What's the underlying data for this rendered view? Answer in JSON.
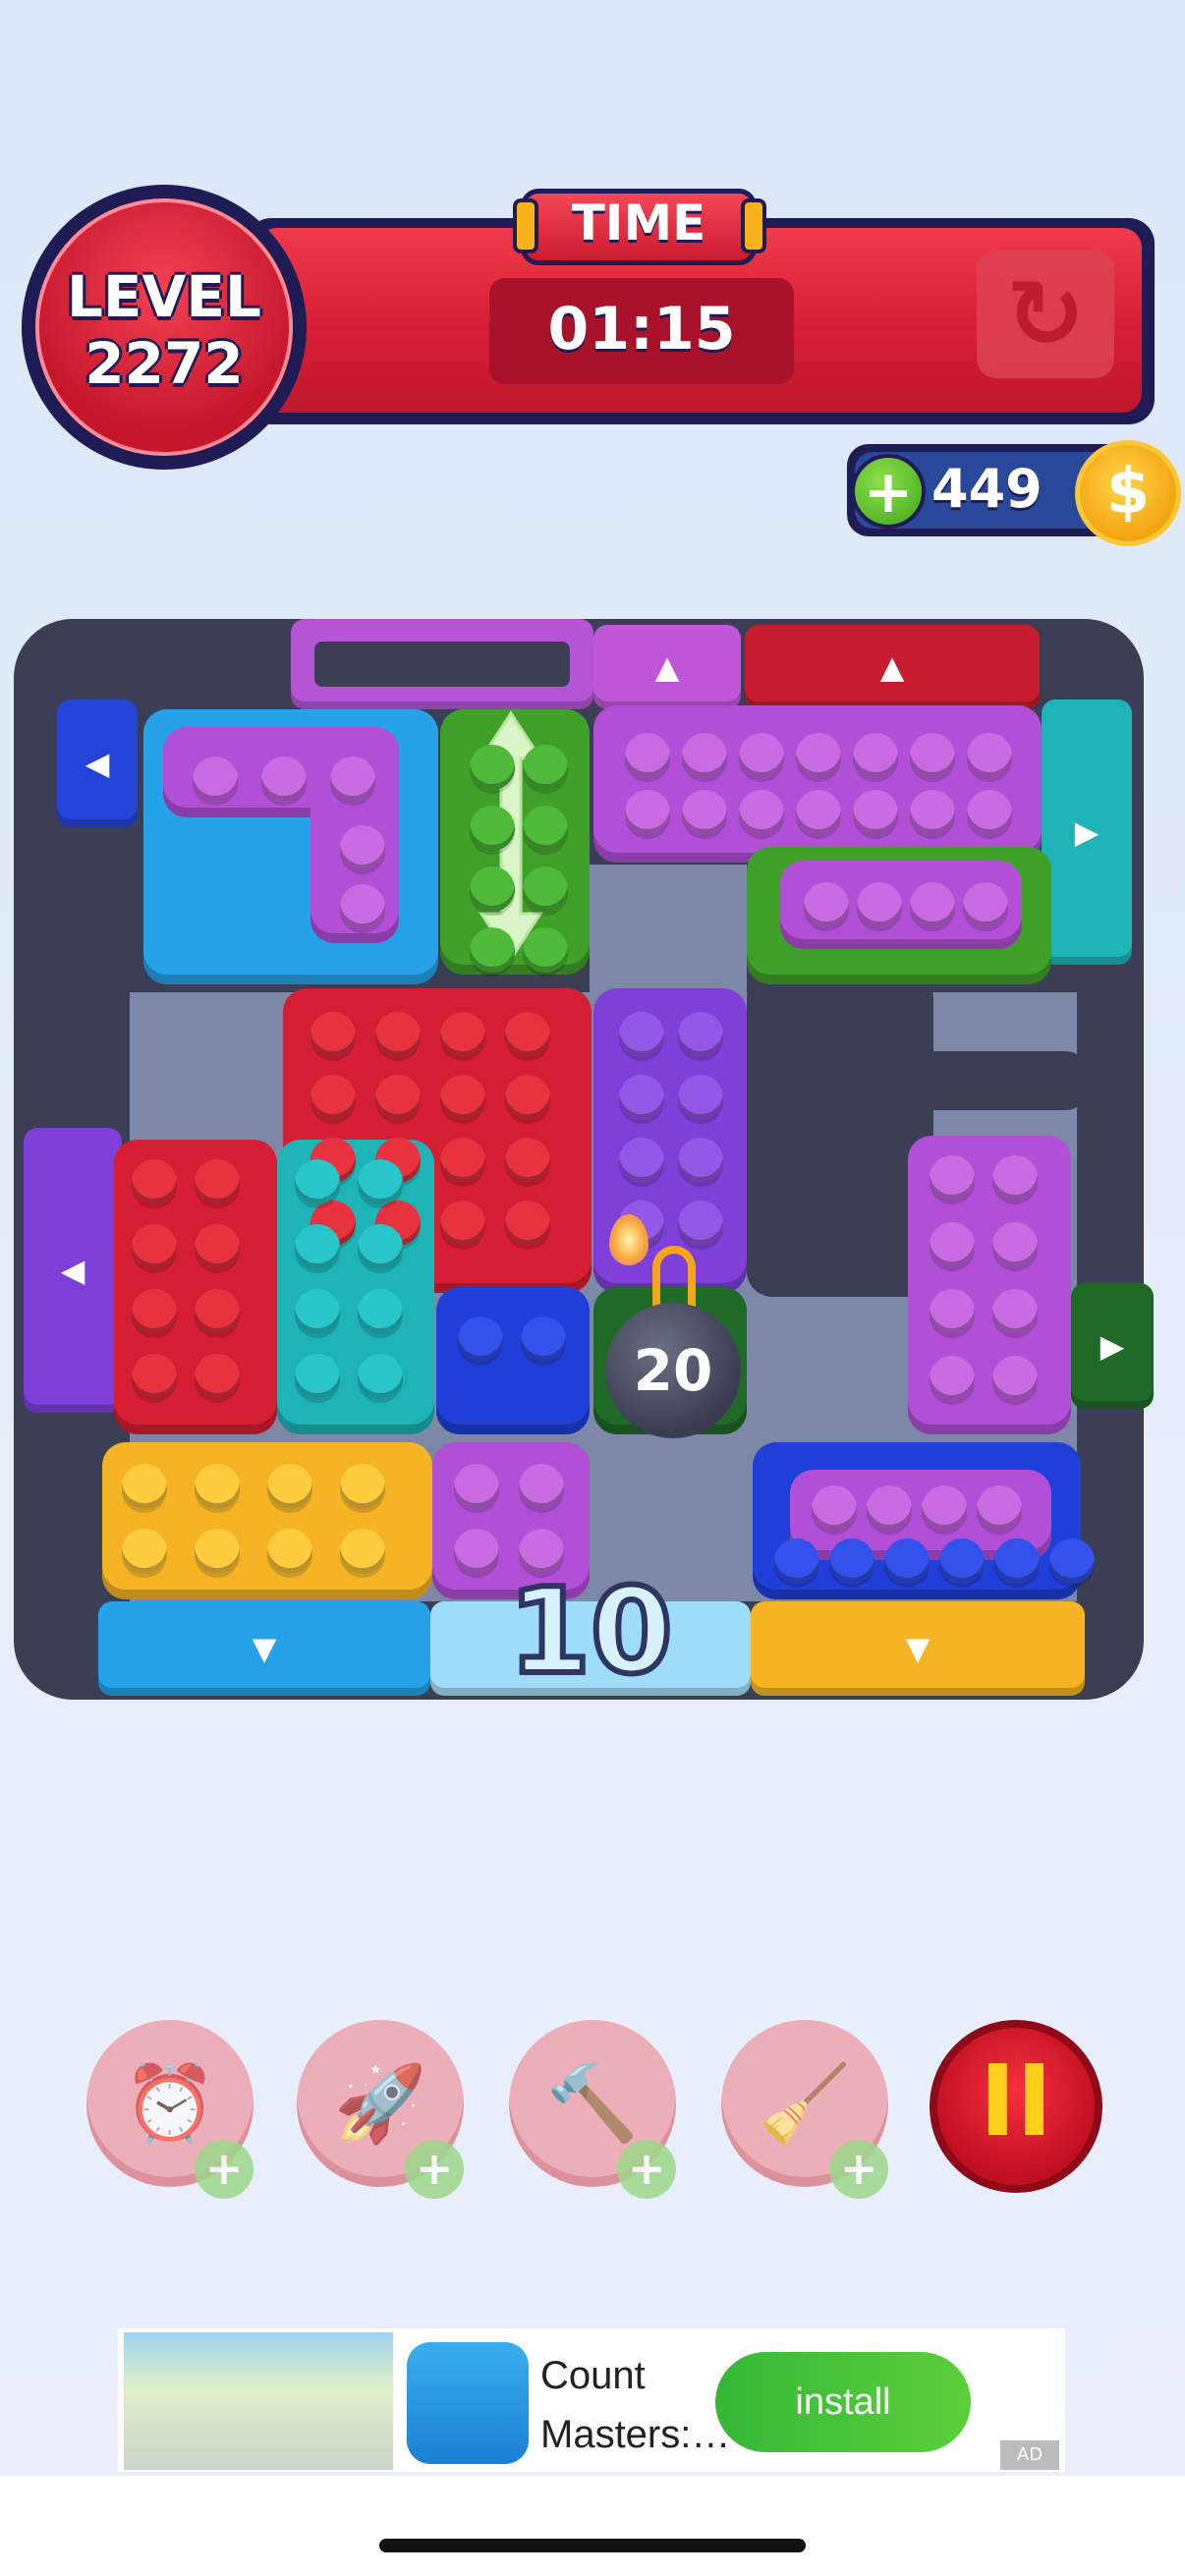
{
  "hud": {
    "level_label": "LEVEL",
    "level_number": "2272",
    "time_label": "TIME",
    "time_value": "01:15",
    "coins": "449",
    "coin_plus": "+",
    "coin_symbol": "$"
  },
  "board": {
    "bomb_counter": "20",
    "remaining_count": "10"
  },
  "boosters": [
    {
      "name": "timer-freeze",
      "icon": "alarm-clock-icon"
    },
    {
      "name": "rocket",
      "icon": "rocket-icon"
    },
    {
      "name": "hammer",
      "icon": "hammer-icon"
    },
    {
      "name": "vacuum",
      "icon": "vacuum-icon"
    }
  ],
  "pause_label": "II",
  "ad": {
    "title": "Count Masters:…",
    "install_label": "install",
    "badge": "AD"
  },
  "colors": {
    "red": "#d51e33",
    "purple": "#a64ad4",
    "green": "#3fa02a",
    "blue": "#1f3fd8",
    "teal": "#1eb3b6",
    "yellow": "#f6b424",
    "violet": "#7f3fd9",
    "sky": "#26a3e8"
  }
}
